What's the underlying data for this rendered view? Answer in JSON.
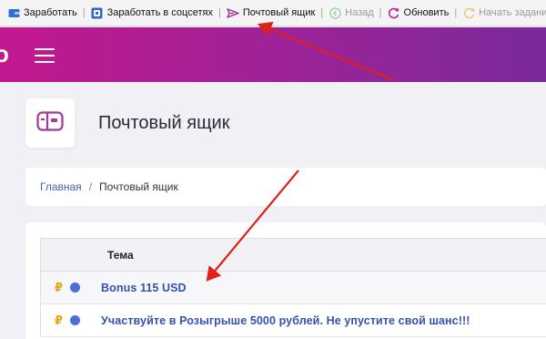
{
  "toolbar": {
    "earn": "Заработать",
    "earn_social": "Заработать в соцсетях",
    "mailbox": "Почтовый ящик",
    "back": "Назад",
    "refresh": "Обновить",
    "restart_task": "Начать задание заново"
  },
  "header": {
    "brand_fragment": "o"
  },
  "page": {
    "title": "Почтовый ящик"
  },
  "breadcrumb": {
    "home": "Главная",
    "separator": "/",
    "current": "Почтовый ящик"
  },
  "messages": {
    "column_subject": "Тема",
    "rows": [
      {
        "currency": "₽",
        "status_color": "#4a6fd8",
        "subject": "Bonus 115 USD"
      },
      {
        "currency": "₽",
        "status_color": "#4a6fd8",
        "subject": "Участвуйте в Розыгрыше 5000 рублей. Не упустите свой шанс!!!"
      }
    ]
  },
  "colors": {
    "header_start": "#c2188d",
    "header_end": "#7a2a9a",
    "link": "#3451b2",
    "annotation_arrow": "#e0201b"
  }
}
